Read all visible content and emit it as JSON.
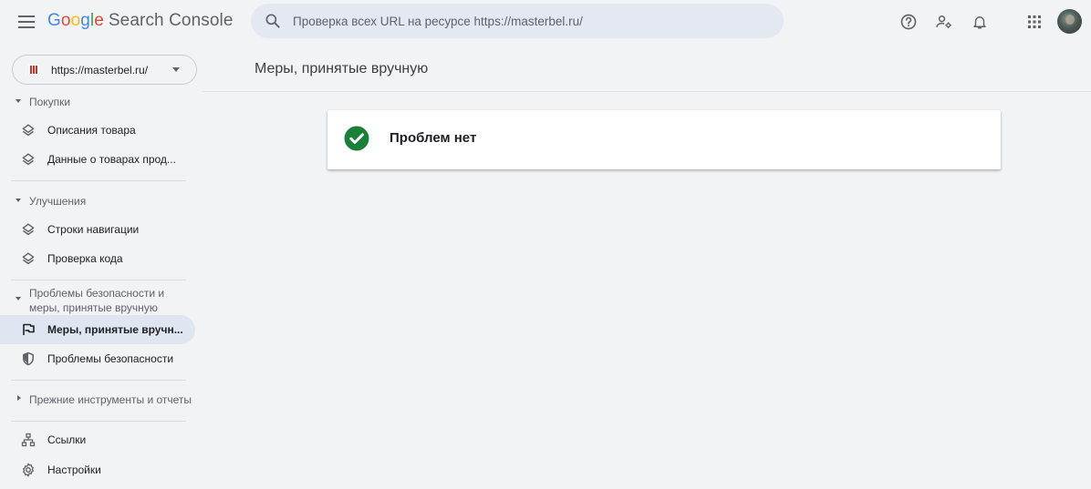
{
  "header": {
    "logo_letters": [
      "G",
      "o",
      "o",
      "g",
      "l",
      "e"
    ],
    "product_name": "Search Console",
    "search_placeholder": "Проверка всех URL на ресурсе https://masterbel.ru/"
  },
  "property": {
    "url": "https://masterbel.ru/"
  },
  "sidebar": {
    "sections": [
      {
        "label": "Покупки",
        "items": [
          "Описания товара",
          "Данные о товарах прод..."
        ]
      },
      {
        "label": "Улучшения",
        "items": [
          "Строки навигации",
          "Проверка кода"
        ]
      },
      {
        "label_line1": "Проблемы безопасности и",
        "label_line2": "меры, принятые вручную",
        "items": [
          "Меры, принятые вручн...",
          "Проблемы безопасности"
        ]
      },
      {
        "label": "Прежние инструменты и отчеты"
      }
    ],
    "bottom_items": [
      "Ссылки",
      "Настройки"
    ]
  },
  "main": {
    "title": "Меры, принятые вручную",
    "status_message": "Проблем нет"
  },
  "colors": {
    "accent_blue": "#1a73e8",
    "success_green": "#188038",
    "active_bg": "#dfe6f1"
  },
  "icons": [
    "menu-icon",
    "search-icon",
    "help-icon",
    "manage-users-icon",
    "bell-icon",
    "apps-icon",
    "layers-icon",
    "flag-icon",
    "shield-icon",
    "links-icon",
    "gear-icon",
    "check-circle-icon"
  ]
}
